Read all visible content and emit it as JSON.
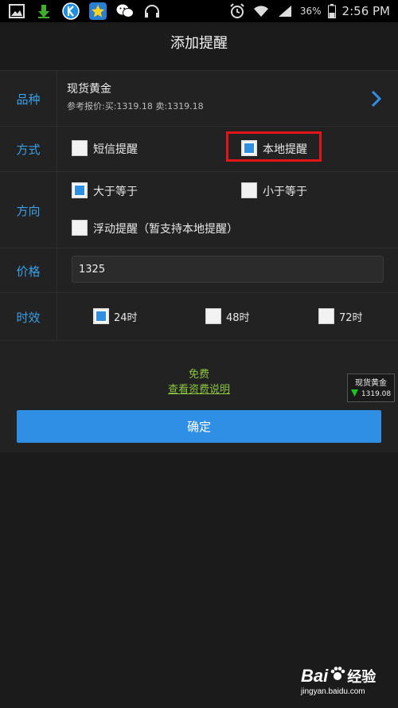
{
  "status": {
    "battery": "36%",
    "time": "2:56 PM"
  },
  "title": "添加提醒",
  "variety": {
    "label": "品种",
    "name": "现货黄金",
    "ref": "参考报价:买:1319.18 卖:1319.18"
  },
  "method": {
    "label": "方式",
    "options": [
      "短信提醒",
      "本地提醒"
    ]
  },
  "direction": {
    "label": "方向",
    "options": [
      "大于等于",
      "小于等于",
      "浮动提醒（暂支持本地提醒）"
    ]
  },
  "price": {
    "label": "价格",
    "value": "1325"
  },
  "validity": {
    "label": "时效",
    "options": [
      "24时",
      "48时",
      "72时"
    ]
  },
  "fee": {
    "free": "免费",
    "link": "查看资费说明"
  },
  "confirm": "确定",
  "ticker": {
    "name": "现货黄金",
    "value": "1319.08",
    "color_down": "#1ec41e"
  },
  "watermark": {
    "brand": "Bai",
    "brand2": "经验",
    "url": "jingyan.baidu.com"
  },
  "colors": {
    "accent": "#2e8fe4",
    "label": "#3aa0e8",
    "highlight": "#e4141b",
    "link": "#8bc53f"
  }
}
